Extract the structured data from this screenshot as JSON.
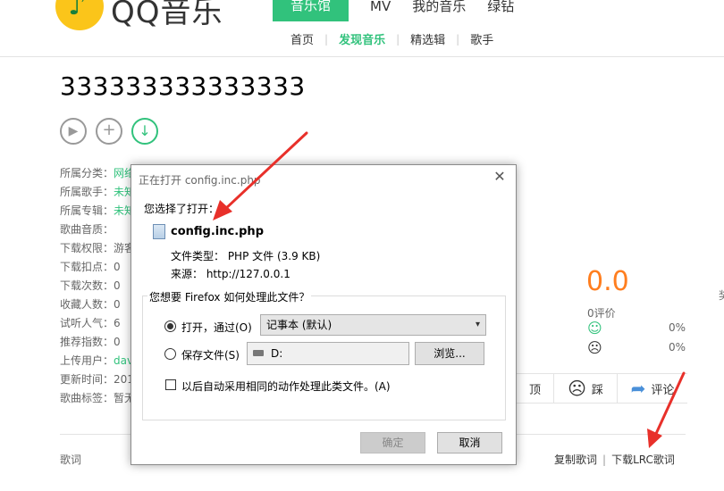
{
  "header": {
    "logo_text": "QQ音乐",
    "nav_main": [
      "音乐馆",
      "MV",
      "我的音乐",
      "绿钻"
    ],
    "nav_sub": [
      "首页",
      "发现音乐",
      "精选辑",
      "歌手"
    ]
  },
  "song": {
    "title": "333333333333333"
  },
  "info": [
    {
      "label": "所属分类：",
      "value": "网络"
    },
    {
      "label": "所属歌手：",
      "value": "未知"
    },
    {
      "label": "所属专辑：",
      "value": "未知"
    },
    {
      "label": "歌曲音质：",
      "value": ""
    },
    {
      "label": "下载权限：",
      "value": "游客"
    },
    {
      "label": "下载扣点：",
      "value": "0"
    },
    {
      "label": "下载次数：",
      "value": "0"
    },
    {
      "label": "收藏人数：",
      "value": "0"
    },
    {
      "label": "试听人气：",
      "value": "6"
    },
    {
      "label": "推荐指数：",
      "value": "0"
    },
    {
      "label": "上传用户：",
      "value": "dav"
    },
    {
      "label": "更新时间：",
      "value": "201"
    },
    {
      "label": "歌曲标签：",
      "value": "暂无"
    }
  ],
  "rating": {
    "score": "0.0",
    "reviews": "0评价",
    "good_pct": "0%",
    "bad_pct": "0%",
    "side_char": "奖"
  },
  "actions": {
    "like": "顶",
    "dislike": "踩",
    "comment": "评论"
  },
  "lyrics": {
    "label": "歌词",
    "copy": "复制歌词",
    "download": "下载LRC歌词"
  },
  "dialog": {
    "title": "正在打开 config.inc.php",
    "close": "✕",
    "chosen_label": "您选择了打开：",
    "file_name": "config.inc.php",
    "file_type": "文件类型：  PHP 文件 (3.9 KB)",
    "source": "来源：   http://127.0.0.1",
    "question": "您想要 Firefox 如何处理此文件？",
    "open_with": "打开，通过(O)",
    "open_app": "记事本 (默认)",
    "save_file": "保存文件(S)",
    "save_path": "D:",
    "browse": "浏览...",
    "auto_label": "以后自动采用相同的动作处理此类文件。(A)",
    "ok": "确定",
    "cancel": "取消"
  },
  "colors": {
    "accent_green": "#31c27c",
    "score_orange": "#ff7e1f",
    "annotation_red": "#e8302a"
  }
}
